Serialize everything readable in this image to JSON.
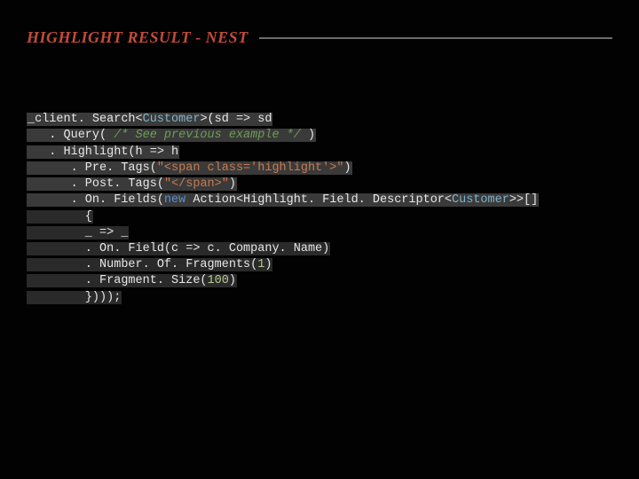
{
  "title": "HIGHLIGHT RESULT - NEST",
  "code": {
    "l1": {
      "a": "_client. Search<",
      "type1": "Customer",
      "b": ">(sd => sd"
    },
    "l2": {
      "a": "   . Query( ",
      "comment": "/* See previous example */",
      "b": " )"
    },
    "l3": "   . Highlight(h => h",
    "l4": {
      "a": "      . Pre. Tags(",
      "s": "\"<span class='highlight'>\"",
      "b": ")"
    },
    "l5": {
      "a": "      . Post. Tags(",
      "s": "\"</span>\"",
      "b": ")"
    },
    "l6": {
      "a": "      . On. Fields(",
      "kw": "new",
      "b": " Action<Highlight. Field. Descriptor<",
      "type1": "Customer",
      "c": ">>[]"
    },
    "l7": "        {",
    "l8": "        _ => _",
    "l9": "        . On. Field(c => c. Company. Name)",
    "l10": {
      "a": "        . Number. Of. Fragments(",
      "n": "1",
      "b": ")"
    },
    "l11": {
      "a": "        . Fragment. Size(",
      "n": "100",
      "b": ")"
    },
    "l12": "        })));"
  }
}
